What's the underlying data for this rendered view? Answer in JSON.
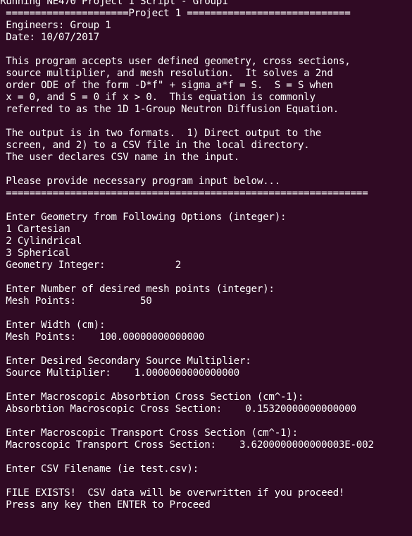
{
  "terminal": {
    "title_line": "Running NE470 Project 1 Script - Group1",
    "lines": [
      " =====================Project 1 ============================",
      " Engineers: Group 1",
      " Date: 10/07/2017",
      "",
      " This program accepts user defined geometry, cross sections,",
      " source multiplier, and mesh resolution.  It solves a 2nd",
      " order ODE of the form -D*f\" + sigma_a*f = S.  S = S when",
      " x = 0, and S = 0 if x > 0.  This equation is commonly",
      " referred to as the 1D 1-Group Neutron Diffusion Equation.",
      "",
      " The output is in two formats.  1) Direct output to the",
      " screen, and 2) to a CSV file in the local directory.",
      " The user declares CSV name in the input.",
      "",
      " Please provide necessary program input below...",
      " ==============================================================",
      "",
      " Enter Geometry from Following Options (integer):",
      " 1 Cartesian",
      " 2 Cylindrical",
      " 3 Spherical",
      " Geometry Integer:            2",
      "",
      " Enter Number of desired mesh points (integer):",
      " Mesh Points:           50",
      "",
      " Enter Width (cm):",
      " Mesh Points:    100.00000000000000",
      "",
      " Enter Desired Secondary Source Multiplier:",
      " Source Multiplier:    1.0000000000000000",
      "",
      " Enter Macroscopic Absorbtion Cross Section (cm^-1):",
      " Absorbtion Macroscopic Cross Section:    0.15320000000000000",
      "",
      " Enter Macroscopic Transport Cross Section (cm^-1):",
      " Macroscopic Transport Cross Section:    3.6200000000000003E-002",
      "",
      " Enter CSV Filename (ie test.csv):",
      "",
      " FILE EXISTS!  CSV data will be overwritten if you proceed!",
      " Press any key then ENTER to Proceed"
    ]
  }
}
